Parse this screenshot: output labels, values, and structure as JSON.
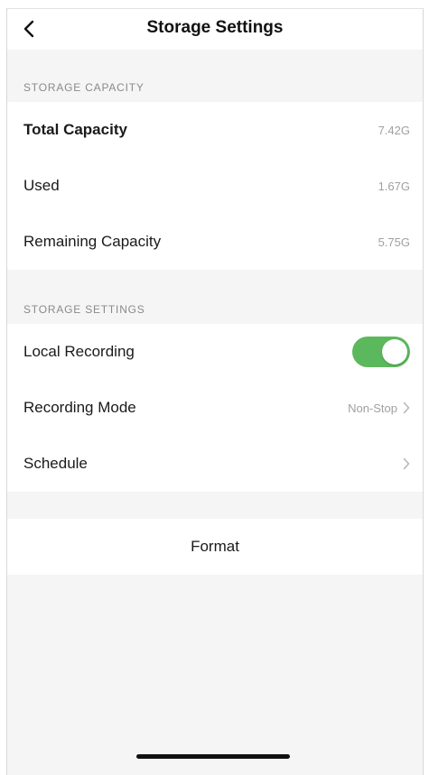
{
  "navbar": {
    "title": "Storage Settings",
    "back_icon": "chevron-left-icon"
  },
  "storage_capacity": {
    "header": "STORAGE CAPACITY",
    "rows": [
      {
        "label": "Total Capacity",
        "value": "7.42G"
      },
      {
        "label": "Used",
        "value": "1.67G"
      },
      {
        "label": "Remaining Capacity",
        "value": "5.75G"
      }
    ]
  },
  "storage_settings": {
    "header": "STORAGE SETTINGS",
    "local_recording": {
      "label": "Local Recording",
      "enabled": true
    },
    "recording_mode": {
      "label": "Recording Mode",
      "value": "Non-Stop"
    },
    "schedule": {
      "label": "Schedule"
    }
  },
  "format": {
    "label": "Format"
  },
  "colors": {
    "toggle_on": "#5cb85c",
    "section_background": "#f5f5f5",
    "secondary_text": "#a0a0a0"
  }
}
